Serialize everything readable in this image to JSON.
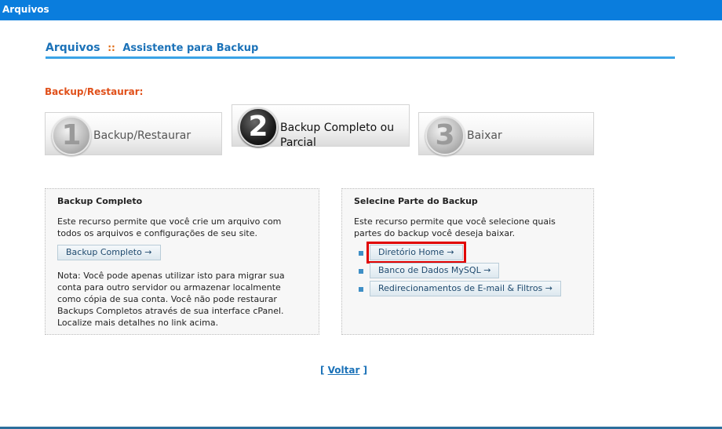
{
  "window": {
    "title": "Arquivos"
  },
  "header": {
    "title": "Arquivos",
    "separator": "::",
    "subtitle": "Assistente para Backup"
  },
  "section_label": "Backup/Restaurar:",
  "steps": [
    {
      "number": "1",
      "label": "Backup/Restaurar",
      "state": "inactive"
    },
    {
      "number": "2",
      "label": "Backup Completo ou Parcial",
      "state": "active"
    },
    {
      "number": "3",
      "label": "Baixar",
      "state": "inactive"
    }
  ],
  "left_panel": {
    "title": "Backup Completo",
    "description": "Este recurso permite que você crie um arquivo com todos os arquivos e configurações de seu site.",
    "button_label": "Backup Completo →",
    "note": "Nota: Você pode apenas utilizar isto para migrar sua conta para outro servidor ou armazenar localmente como cópia de sua conta. Você não pode restaurar Backups Completos através de sua interface cPanel. Localize mais detalhes no link acima."
  },
  "right_panel": {
    "title": "Selecine Parte do Backup",
    "description": "Este recurso permite que você selecione quais partes do backup você deseja baixar.",
    "options": [
      {
        "label": "Diretório Home →",
        "highlighted": true
      },
      {
        "label": "Banco de Dados MySQL →",
        "highlighted": false
      },
      {
        "label": "Redirecionamentos de E-mail & Filtros →",
        "highlighted": false
      }
    ]
  },
  "footer": {
    "open_bracket": "[",
    "back_link": "Voltar",
    "close_bracket": "]"
  },
  "colors": {
    "topbar": "#0a7ddd",
    "header_text": "#1b72b8",
    "header_rule": "#3aa3e6",
    "section_label": "#e0501a",
    "highlight_outline": "#e00000"
  }
}
